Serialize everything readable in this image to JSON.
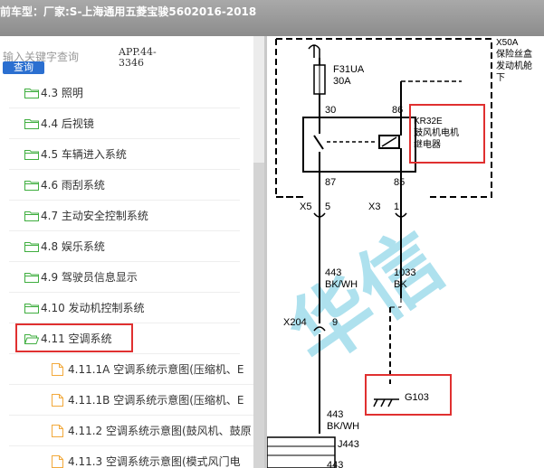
{
  "header": {
    "title": "前车型：厂家:S-上海通用五菱宝骏5602016-2018"
  },
  "search": {
    "placeholder": "输入关键字查询",
    "button_label": "查询",
    "app_label": "APP.44-3346"
  },
  "tree": {
    "folders": [
      {
        "label": "4.3 照明"
      },
      {
        "label": "4.4 后视镜"
      },
      {
        "label": "4.5 车辆进入系统"
      },
      {
        "label": "4.6 雨刮系统"
      },
      {
        "label": "4.7 主动安全控制系统"
      },
      {
        "label": "4.8 娱乐系统"
      },
      {
        "label": "4.9 驾驶员信息显示"
      },
      {
        "label": "4.10 发动机控制系统"
      },
      {
        "label": "4.11 空调系统"
      }
    ],
    "files": [
      {
        "label": "4.11.1A 空调系统示意图(压缩机、E"
      },
      {
        "label": "4.11.1B 空调系统示意图(压缩机、E"
      },
      {
        "label": "4.11.2 空调系统示意图(鼓风机、鼓原"
      },
      {
        "label": "4.11.3 空调系统示意图(模式风门电"
      }
    ]
  },
  "diagram": {
    "fuse_name": "F31UA",
    "fuse_rating": "30A",
    "box_name": "X50A",
    "box_desc": [
      "保险丝盒",
      "发动机舱",
      "下"
    ],
    "relay_name": "KR32E",
    "relay_desc": [
      "鼓风机电机",
      "继电器"
    ],
    "pins": {
      "p30": "30",
      "p86": "86",
      "p87": "87",
      "p85": "85"
    },
    "connectors": {
      "x5": "X5",
      "five": "5",
      "x3": "X3",
      "one": "1"
    },
    "wire1": [
      "443",
      "BK/WH"
    ],
    "wire2": [
      "1033",
      "BK"
    ],
    "x204": "X204",
    "nine": "9",
    "ground": "G103",
    "wire3": [
      "443",
      "BK/WH"
    ],
    "j443": "J443",
    "bottom_443": "443",
    "watermark": "华信"
  },
  "colors": {
    "highlight": "#e03030",
    "folder": "#3fae3f",
    "file": "#f2a93b"
  }
}
